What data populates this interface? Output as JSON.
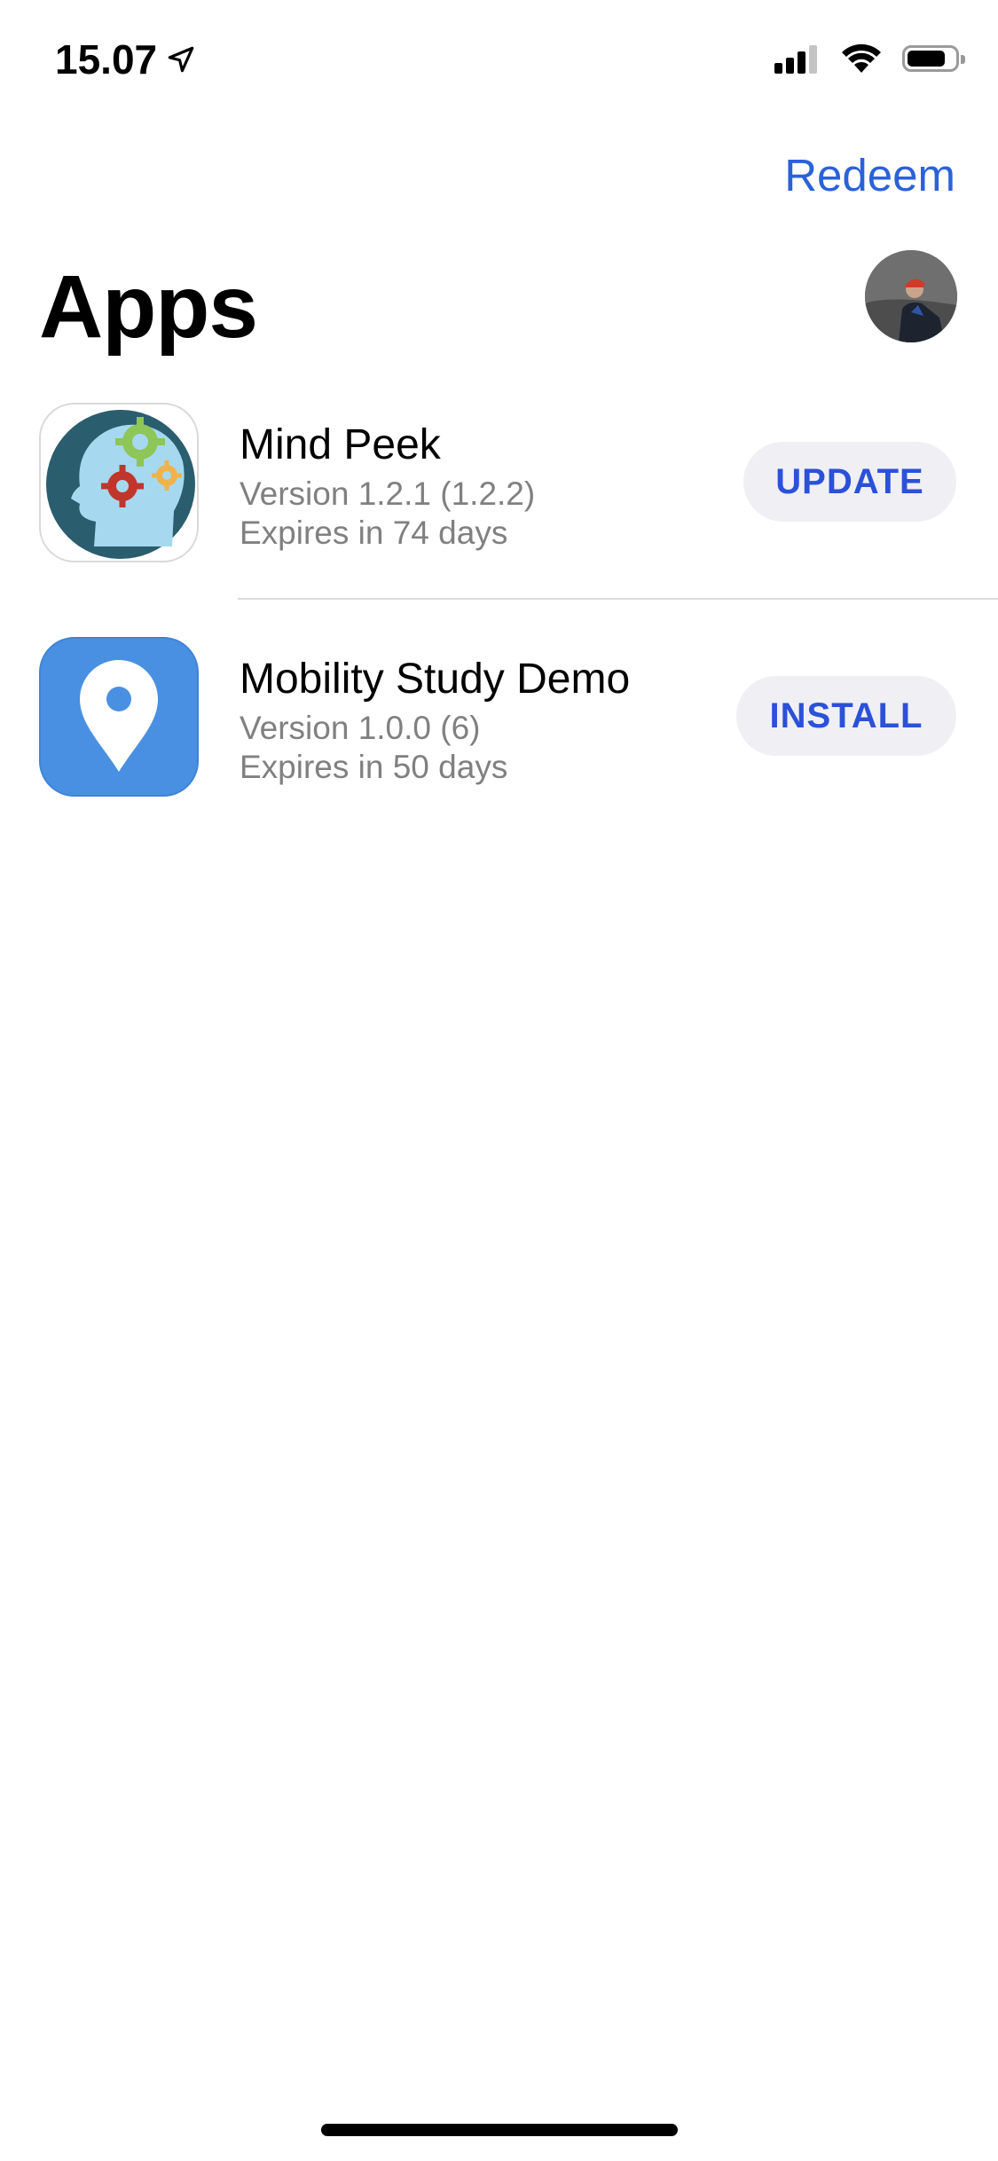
{
  "status_bar": {
    "time": "15.07",
    "icons": [
      "location-arrow-icon",
      "cellular-signal-icon",
      "wifi-icon",
      "battery-icon"
    ],
    "battery_level": 0.8
  },
  "header": {
    "redeem_label": "Redeem",
    "title": "Apps",
    "avatar": "profile-avatar"
  },
  "apps": [
    {
      "name": "Mind Peek",
      "version": "Version 1.2.1 (1.2.2)",
      "expires": "Expires in 74 days",
      "action": "UPDATE",
      "icon": "mind-peek-app-icon"
    },
    {
      "name": "Mobility Study Demo",
      "version": "Version 1.0.0 (6)",
      "expires": "Expires in 50 days",
      "action": "INSTALL",
      "icon": "map-pin-app-icon"
    }
  ],
  "colors": {
    "accent": "#2a62d9",
    "button_bg": "#efeff4",
    "secondary_text": "#808080",
    "mobility_icon_bg": "#4a90e2"
  }
}
